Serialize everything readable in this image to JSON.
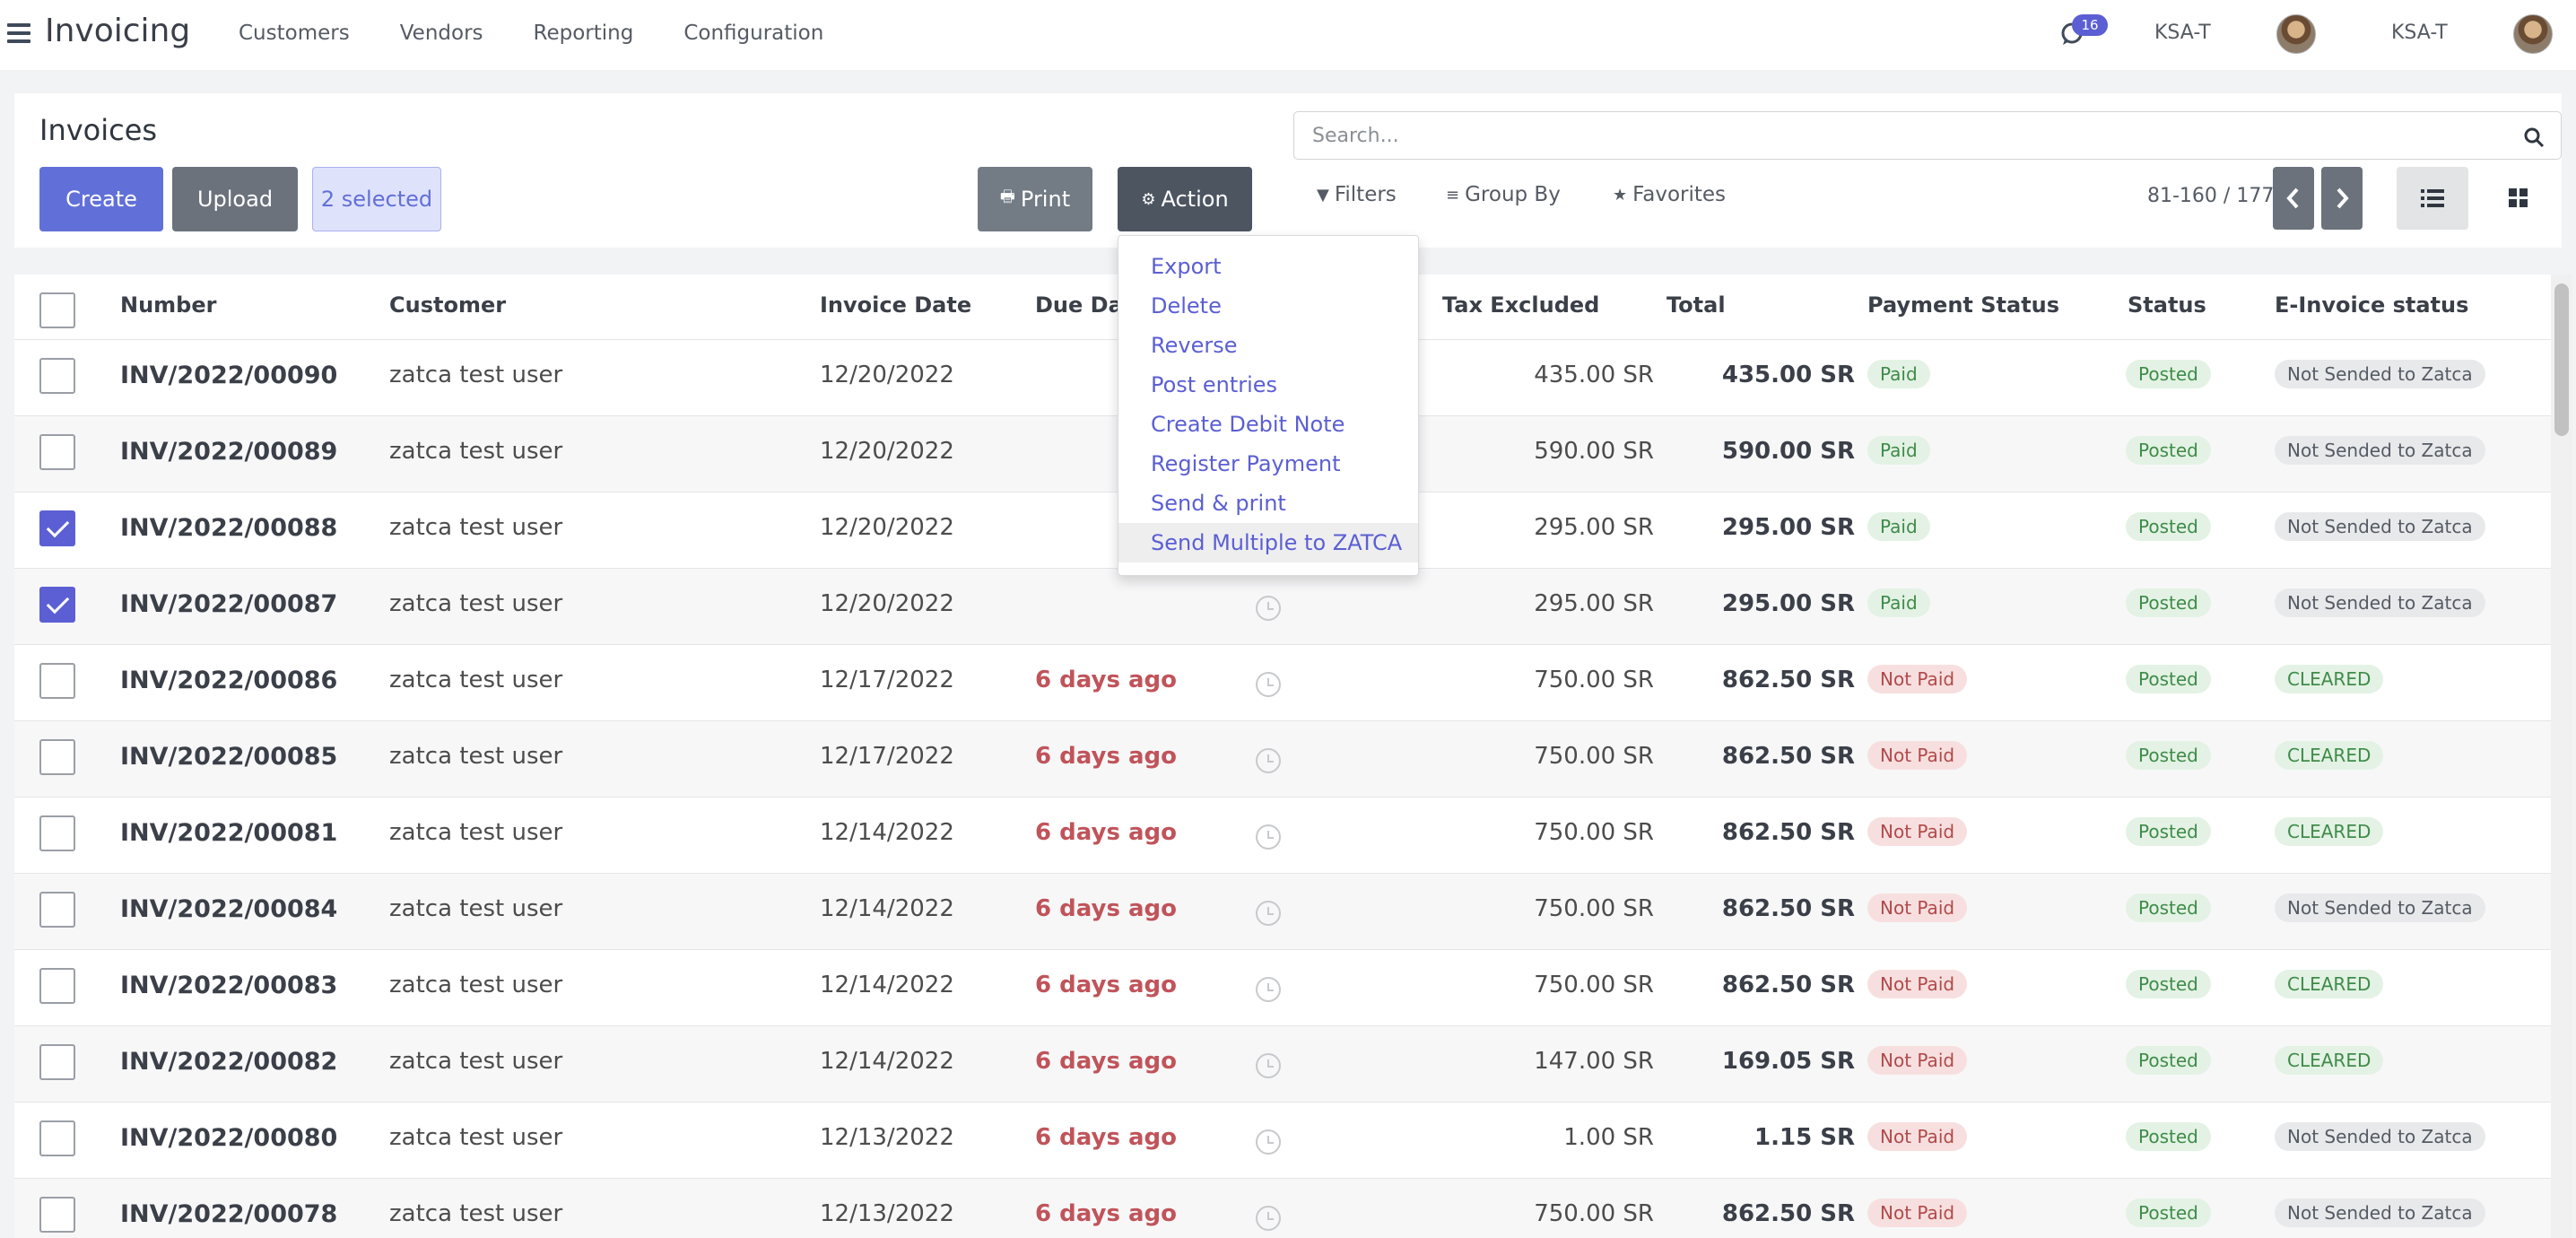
{
  "navbar": {
    "app_title": "Invoicing",
    "menu": [
      "Customers",
      "Vendors",
      "Reporting",
      "Configuration"
    ],
    "chat_count": "16",
    "companies": [
      "KSA-T",
      "KSA-T"
    ]
  },
  "control_panel": {
    "breadcrumb": "Invoices",
    "create_label": "Create",
    "upload_label": "Upload",
    "selected_label": "2 selected",
    "print_label": "Print",
    "action_label": "Action",
    "search_placeholder": "Search...",
    "filters_label": "Filters",
    "groupby_label": "Group By",
    "favorites_label": "Favorites",
    "pager": "81-160 / 177"
  },
  "action_menu": [
    "Export",
    "Delete",
    "Reverse",
    "Post entries",
    "Create Debit Note",
    "Register Payment",
    "Send & print",
    "Send Multiple to ZATCA"
  ],
  "columns": [
    "Number",
    "Customer",
    "Invoice Date",
    "Due Date",
    "Tax Excluded",
    "Total",
    "Payment Status",
    "Status",
    "E-Invoice status"
  ],
  "rows": [
    {
      "number": "INV/2022/00090",
      "customer": "zatca test user",
      "date": "12/20/2022",
      "due": "",
      "tax_excluded": "435.00 SR",
      "total": "435.00 SR",
      "payment": "Paid",
      "status": "Posted",
      "einvoice": "Not Sended to Zatca",
      "checked": false
    },
    {
      "number": "INV/2022/00089",
      "customer": "zatca test user",
      "date": "12/20/2022",
      "due": "",
      "tax_excluded": "590.00 SR",
      "total": "590.00 SR",
      "payment": "Paid",
      "status": "Posted",
      "einvoice": "Not Sended to Zatca",
      "checked": false
    },
    {
      "number": "INV/2022/00088",
      "customer": "zatca test user",
      "date": "12/20/2022",
      "due": "",
      "tax_excluded": "295.00 SR",
      "total": "295.00 SR",
      "payment": "Paid",
      "status": "Posted",
      "einvoice": "Not Sended to Zatca",
      "checked": true
    },
    {
      "number": "INV/2022/00087",
      "customer": "zatca test user",
      "date": "12/20/2022",
      "due": "",
      "tax_excluded": "295.00 SR",
      "total": "295.00 SR",
      "payment": "Paid",
      "status": "Posted",
      "einvoice": "Not Sended to Zatca",
      "checked": true
    },
    {
      "number": "INV/2022/00086",
      "customer": "zatca test user",
      "date": "12/17/2022",
      "due": "6 days ago",
      "tax_excluded": "750.00 SR",
      "total": "862.50 SR",
      "payment": "Not Paid",
      "status": "Posted",
      "einvoice": "CLEARED",
      "checked": false
    },
    {
      "number": "INV/2022/00085",
      "customer": "zatca test user",
      "date": "12/17/2022",
      "due": "6 days ago",
      "tax_excluded": "750.00 SR",
      "total": "862.50 SR",
      "payment": "Not Paid",
      "status": "Posted",
      "einvoice": "CLEARED",
      "checked": false
    },
    {
      "number": "INV/2022/00081",
      "customer": "zatca test user",
      "date": "12/14/2022",
      "due": "6 days ago",
      "tax_excluded": "750.00 SR",
      "total": "862.50 SR",
      "payment": "Not Paid",
      "status": "Posted",
      "einvoice": "CLEARED",
      "checked": false
    },
    {
      "number": "INV/2022/00084",
      "customer": "zatca test user",
      "date": "12/14/2022",
      "due": "6 days ago",
      "tax_excluded": "750.00 SR",
      "total": "862.50 SR",
      "payment": "Not Paid",
      "status": "Posted",
      "einvoice": "Not Sended to Zatca",
      "checked": false
    },
    {
      "number": "INV/2022/00083",
      "customer": "zatca test user",
      "date": "12/14/2022",
      "due": "6 days ago",
      "tax_excluded": "750.00 SR",
      "total": "862.50 SR",
      "payment": "Not Paid",
      "status": "Posted",
      "einvoice": "CLEARED",
      "checked": false
    },
    {
      "number": "INV/2022/00082",
      "customer": "zatca test user",
      "date": "12/14/2022",
      "due": "6 days ago",
      "tax_excluded": "147.00 SR",
      "total": "169.05 SR",
      "payment": "Not Paid",
      "status": "Posted",
      "einvoice": "CLEARED",
      "checked": false
    },
    {
      "number": "INV/2022/00080",
      "customer": "zatca test user",
      "date": "12/13/2022",
      "due": "6 days ago",
      "tax_excluded": "1.00 SR",
      "total": "1.15 SR",
      "payment": "Not Paid",
      "status": "Posted",
      "einvoice": "Not Sended to Zatca",
      "checked": false
    },
    {
      "number": "INV/2022/00078",
      "customer": "zatca test user",
      "date": "12/13/2022",
      "due": "6 days ago",
      "tax_excluded": "750.00 SR",
      "total": "862.50 SR",
      "payment": "Not Paid",
      "status": "Posted",
      "einvoice": "Not Sended to Zatca",
      "checked": false
    }
  ],
  "colors": {
    "primary": "#6170d8",
    "dark_button": "#4d5561",
    "overdue": "#c0545a",
    "success": "#3f8b49"
  }
}
